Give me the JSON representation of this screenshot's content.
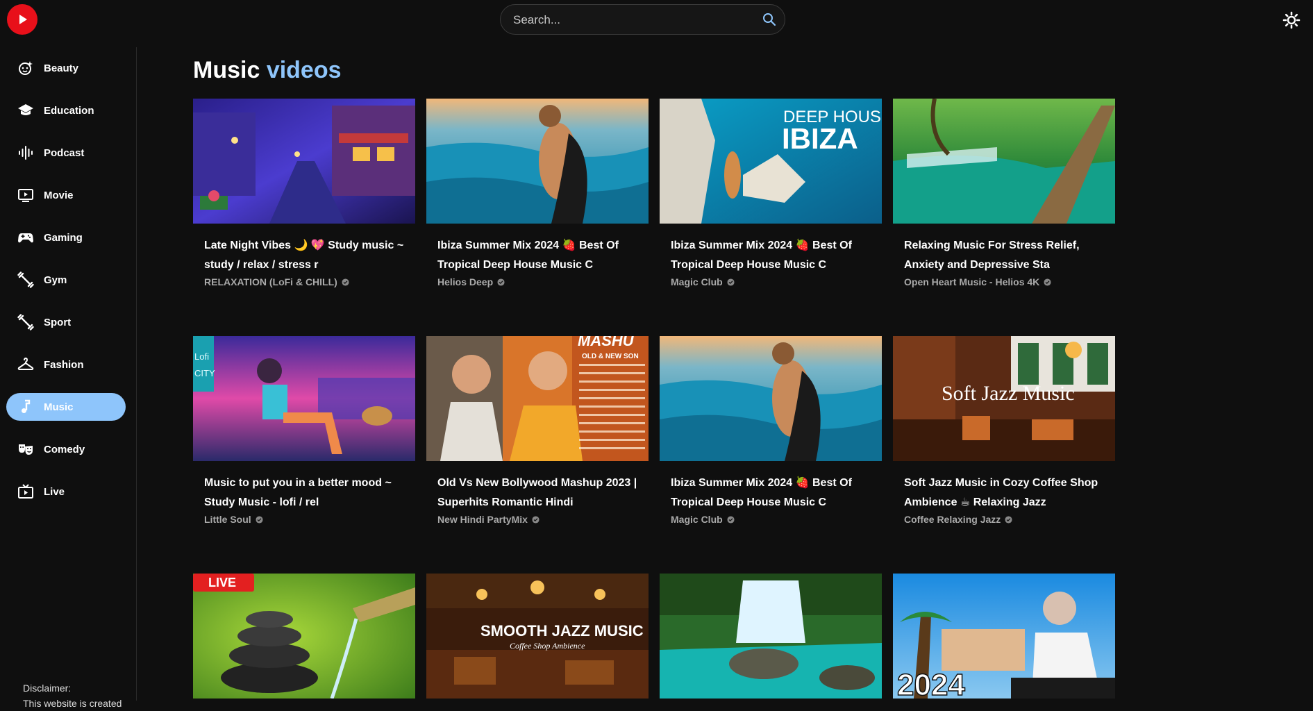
{
  "search": {
    "placeholder": "Search..."
  },
  "sidebar": {
    "items": [
      {
        "label": "Beauty",
        "icon": "beauty-icon",
        "active": false
      },
      {
        "label": "Education",
        "icon": "graduation-cap-icon",
        "active": false
      },
      {
        "label": "Podcast",
        "icon": "podcast-icon",
        "active": false
      },
      {
        "label": "Movie",
        "icon": "movie-icon",
        "active": false
      },
      {
        "label": "Gaming",
        "icon": "gamepad-icon",
        "active": false
      },
      {
        "label": "Gym",
        "icon": "dumbbell-icon",
        "active": false
      },
      {
        "label": "Sport",
        "icon": "sport-icon",
        "active": false
      },
      {
        "label": "Fashion",
        "icon": "hanger-icon",
        "active": false
      },
      {
        "label": "Music",
        "icon": "music-note-icon",
        "active": true
      },
      {
        "label": "Comedy",
        "icon": "theater-masks-icon",
        "active": false
      },
      {
        "label": "Live",
        "icon": "live-tv-icon",
        "active": false
      }
    ],
    "disclaimer_heading": "Disclaimer:",
    "disclaimer_text": "This website is created"
  },
  "main": {
    "title_prefix": "Music",
    "title_accent": "videos",
    "videos": [
      {
        "title": "Late Night Vibes 🌙 💖 Study music ~ study / relax / stress r",
        "channel": "RELAXATION (LoFi & CHILL)"
      },
      {
        "title": "Ibiza Summer Mix 2024 🍓 Best Of Tropical Deep House Music C",
        "channel": "Helios Deep"
      },
      {
        "title": "Ibiza Summer Mix 2024 🍓 Best Of Tropical Deep House Music C",
        "channel": "Magic Club",
        "thumb_text": [
          "DEEP HOUSE",
          "IBIZA"
        ]
      },
      {
        "title": "Relaxing Music For Stress Relief, Anxiety and Depressive Sta",
        "channel": "Open Heart Music - Helios 4K"
      },
      {
        "title": "Music to put you in a better mood ~ Study Music - lofi / rel",
        "channel": "Little Soul",
        "thumb_text": [
          "Lofi",
          "CITY"
        ]
      },
      {
        "title": "Old Vs New Bollywood Mashup 2023 | Superhits Romantic Hindi",
        "channel": "New Hindi PartyMix",
        "thumb_text": [
          "MASHU",
          "OLD & NEW SON"
        ]
      },
      {
        "title": "Ibiza Summer Mix 2024 🍓 Best Of Tropical Deep House Music C",
        "channel": "Magic Club"
      },
      {
        "title": "Soft Jazz Music in Cozy Coffee Shop Ambience ☕ Relaxing Jazz",
        "channel": "Coffee Relaxing Jazz",
        "thumb_text": [
          "Soft Jazz Music"
        ]
      },
      {
        "title": "",
        "channel": "",
        "thumb_text": [
          "LIVE"
        ]
      },
      {
        "title": "",
        "channel": "",
        "thumb_text": [
          "SMOOTH JAZZ MUSIC",
          "Coffee Shop Ambience"
        ]
      },
      {
        "title": "",
        "channel": ""
      },
      {
        "title": "",
        "channel": "",
        "thumb_text": [
          "2024"
        ]
      }
    ]
  },
  "colors": {
    "accent": "#8ec5fb",
    "logo_red": "#e8101a",
    "background": "#0f0f0f"
  }
}
